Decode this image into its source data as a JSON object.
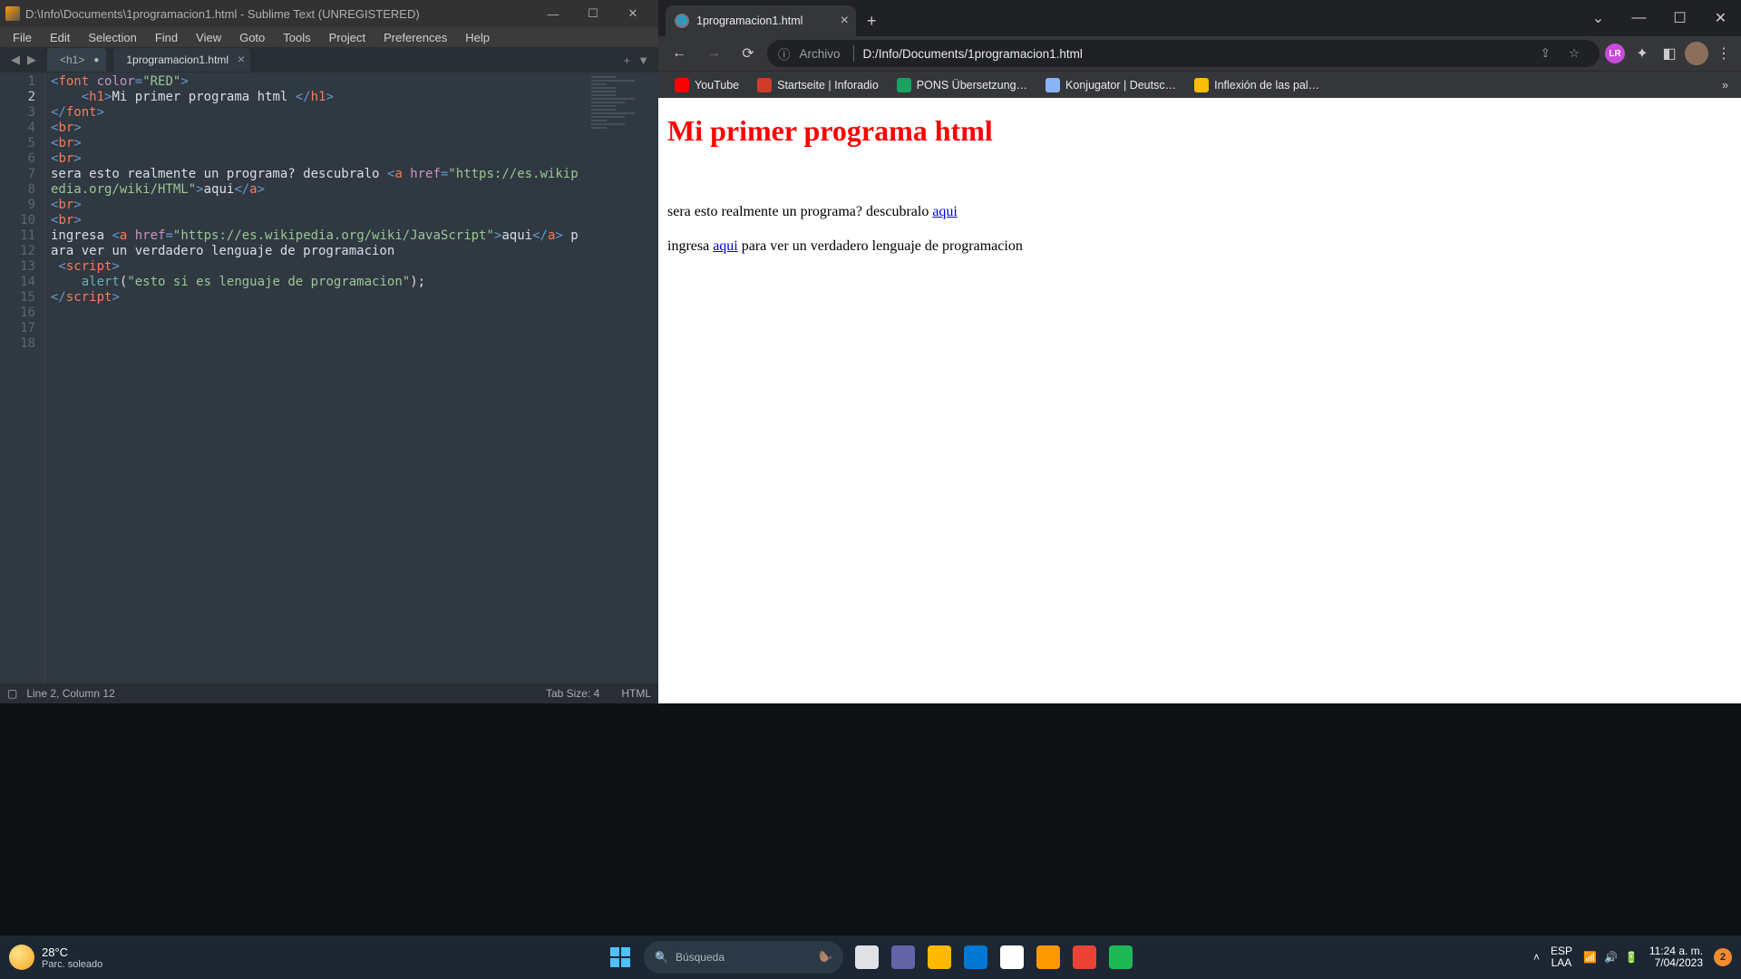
{
  "sublime": {
    "title": "D:\\Info\\Documents\\1programacion1.html - Sublime Text (UNREGISTERED)",
    "menus": [
      "File",
      "Edit",
      "Selection",
      "Find",
      "View",
      "Goto",
      "Tools",
      "Project",
      "Preferences",
      "Help"
    ],
    "tabs": [
      {
        "label": "<h1>",
        "unsaved": true,
        "active": false
      },
      {
        "label": "1programacion1.html",
        "unsaved": false,
        "active": true
      }
    ],
    "status_left": "Line 2, Column 12",
    "status_tabsize": "Tab Size: 4",
    "status_lang": "HTML",
    "code_lines": [
      {
        "n": 1,
        "segs": [
          [
            "<",
            "punc"
          ],
          [
            "font",
            "tag"
          ],
          [
            " ",
            "txt"
          ],
          [
            "color",
            "attr"
          ],
          [
            "=",
            "punc"
          ],
          [
            "\"RED\"",
            "str"
          ],
          [
            ">",
            "punc"
          ]
        ]
      },
      {
        "n": 2,
        "cur": true,
        "segs": [
          [
            "    ",
            "txt"
          ],
          [
            "<",
            "punc"
          ],
          [
            "h1",
            "tag"
          ],
          [
            ">",
            "punc"
          ],
          [
            "Mi primer programa html ",
            "txt"
          ],
          [
            "</",
            "punc"
          ],
          [
            "h1",
            "tag"
          ],
          [
            ">",
            "punc"
          ]
        ]
      },
      {
        "n": 3,
        "segs": [
          [
            "</",
            "punc"
          ],
          [
            "font",
            "tag"
          ],
          [
            ">",
            "punc"
          ]
        ]
      },
      {
        "n": 4,
        "segs": [
          [
            "",
            "txt"
          ]
        ]
      },
      {
        "n": 5,
        "segs": [
          [
            "<",
            "punc"
          ],
          [
            "br",
            "tag"
          ],
          [
            ">",
            "punc"
          ]
        ]
      },
      {
        "n": 6,
        "segs": [
          [
            "<",
            "punc"
          ],
          [
            "br",
            "tag"
          ],
          [
            ">",
            "punc"
          ]
        ]
      },
      {
        "n": 7,
        "segs": [
          [
            "<",
            "punc"
          ],
          [
            "br",
            "tag"
          ],
          [
            ">",
            "punc"
          ]
        ]
      },
      {
        "n": 8,
        "segs": [
          [
            "sera esto realmente un programa? descubralo ",
            "txt"
          ],
          [
            "<",
            "punc"
          ],
          [
            "a",
            "tag"
          ],
          [
            " ",
            "txt"
          ],
          [
            "href",
            "attr"
          ],
          [
            "=",
            "punc"
          ],
          [
            "\"https://es.wikipedia.org/wiki/HTML\"",
            "str"
          ],
          [
            ">",
            "punc"
          ],
          [
            "aqui",
            "txt"
          ],
          [
            "</",
            "punc"
          ],
          [
            "a",
            "tag"
          ],
          [
            ">",
            "punc"
          ]
        ]
      },
      {
        "n": 9,
        "segs": [
          [
            "<",
            "punc"
          ],
          [
            "br",
            "tag"
          ],
          [
            ">",
            "punc"
          ]
        ]
      },
      {
        "n": 10,
        "segs": [
          [
            "<",
            "punc"
          ],
          [
            "br",
            "tag"
          ],
          [
            ">",
            "punc"
          ]
        ]
      },
      {
        "n": 11,
        "segs": [
          [
            "ingresa ",
            "txt"
          ],
          [
            "<",
            "punc"
          ],
          [
            "a",
            "tag"
          ],
          [
            " ",
            "txt"
          ],
          [
            "href",
            "attr"
          ],
          [
            "=",
            "punc"
          ],
          [
            "\"https://es.wikipedia.org/wiki/JavaScript\"",
            "str"
          ],
          [
            ">",
            "punc"
          ],
          [
            "aqui",
            "txt"
          ],
          [
            "</",
            "punc"
          ],
          [
            "a",
            "tag"
          ],
          [
            ">",
            "punc"
          ],
          [
            " para ver un verdadero lenguaje de programacion",
            "txt"
          ]
        ]
      },
      {
        "n": 12,
        "segs": [
          [
            "",
            "txt"
          ]
        ]
      },
      {
        "n": 13,
        "segs": [
          [
            "",
            "txt"
          ]
        ]
      },
      {
        "n": 14,
        "segs": [
          [
            "",
            "txt"
          ]
        ]
      },
      {
        "n": 15,
        "segs": [
          [
            " ",
            "txt"
          ],
          [
            "<",
            "punc"
          ],
          [
            "script",
            "tag"
          ],
          [
            ">",
            "punc"
          ]
        ]
      },
      {
        "n": 16,
        "segs": [
          [
            "    ",
            "txt"
          ],
          [
            "alert",
            "func"
          ],
          [
            "(",
            "txt"
          ],
          [
            "\"esto si es lenguaje de programacion\"",
            "str"
          ],
          [
            ");",
            "txt"
          ]
        ]
      },
      {
        "n": 17,
        "segs": [
          [
            "</",
            "punc"
          ],
          [
            "script",
            "tag"
          ],
          [
            ">",
            "punc"
          ]
        ]
      },
      {
        "n": 18,
        "segs": [
          [
            "",
            "txt"
          ]
        ]
      }
    ]
  },
  "chrome": {
    "tab_title": "1programacion1.html",
    "omni_prefix": "Archivo",
    "omni_url": "D:/Info/Documents/1programacion1.html",
    "bookmarks": [
      {
        "label": "YouTube",
        "color": "#ff0000"
      },
      {
        "label": "Startseite | Inforadio",
        "color": "#d13b2a"
      },
      {
        "label": "PONS Übersetzung…",
        "color": "#1aa260"
      },
      {
        "label": "Konjugator | Deutsc…",
        "color": "#8ab4f8"
      },
      {
        "label": "Inflexión de las pal…",
        "color": "#fbbc04"
      }
    ],
    "ext_badge": "LR",
    "page": {
      "h1": "Mi primer programa html",
      "p1_a": "sera esto realmente un programa? descubralo ",
      "p1_link": "aqui",
      "p2_a": "ingresa ",
      "p2_link": "aqui",
      "p2_b": " para ver un verdadero lenguaje de programacion"
    }
  },
  "taskbar": {
    "temp": "28°C",
    "cond": "Parc. soleado",
    "search_placeholder": "Búsqueda",
    "lang_top": "ESP",
    "lang_bot": "LAA",
    "time": "11:24 a. m.",
    "date": "7/04/2023",
    "notif_count": "2",
    "apps": [
      {
        "name": "task-view",
        "color": "#dfe1e5"
      },
      {
        "name": "chat",
        "color": "#6264a7"
      },
      {
        "name": "explorer",
        "color": "#ffb900"
      },
      {
        "name": "edge",
        "color": "#0078d4"
      },
      {
        "name": "store",
        "color": "#ffffff"
      },
      {
        "name": "sublime",
        "color": "#ff9800"
      },
      {
        "name": "chrome",
        "color": "#ea4335"
      },
      {
        "name": "spotify",
        "color": "#1db954"
      }
    ]
  }
}
